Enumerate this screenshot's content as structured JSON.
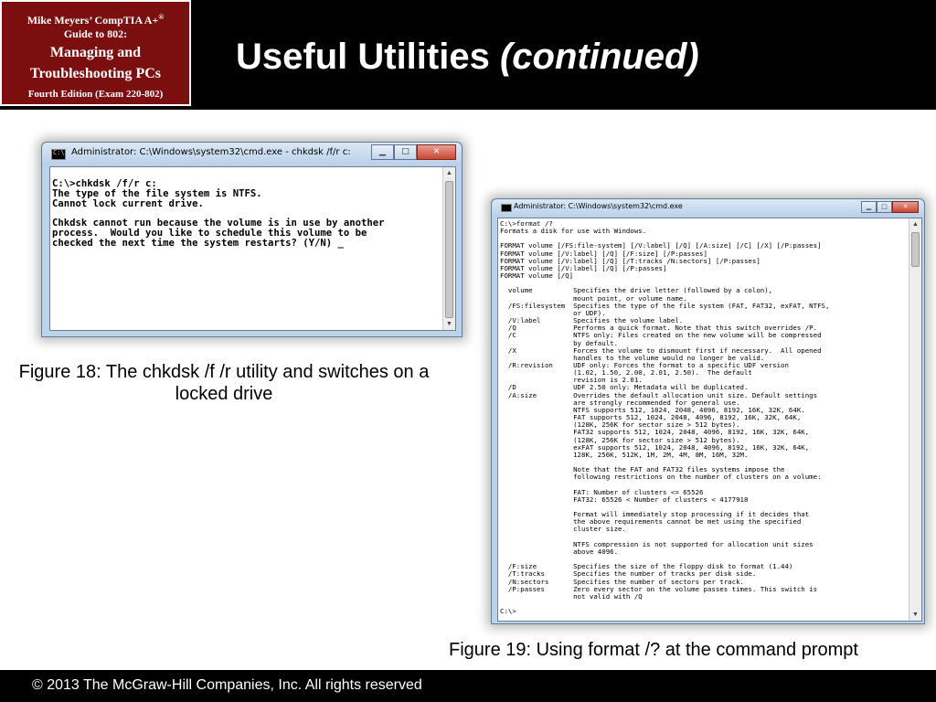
{
  "header": {
    "badge": {
      "line1": "Mike Meyers’ CompTIA A+",
      "registered": "®",
      "line2": "Guide to 802:",
      "line3": "Managing and",
      "line4": "Troubleshooting PCs",
      "line5": "Fourth Edition (Exam 220-802)"
    },
    "title": "Useful Utilities",
    "title_italic": "(continued)"
  },
  "window1": {
    "title": "Administrator: C:\\Windows\\system32\\cmd.exe - chkdsk  /f/r c:",
    "minimize": "▁",
    "maximize": "□",
    "close": "✕",
    "scroll_up": "▲",
    "scroll_down": "▼",
    "console_text": "C:\\>chkdsk /f/r c:\nThe type of the file system is NTFS.\nCannot lock current drive.\n\nChkdsk cannot run because the volume is in use by another\nprocess.  Would you like to schedule this volume to be\nchecked the next time the system restarts? (Y/N) _"
  },
  "window2": {
    "title": "Administrator: C:\\Windows\\system32\\cmd.exe",
    "minimize": "▁",
    "maximize": "□",
    "close": "✕",
    "scroll_up": "▲",
    "scroll_down": "▼",
    "console_text": "C:\\>format /?\nFormats a disk for use with Windows.\n\nFORMAT volume [/FS:file-system] [/V:label] [/Q] [/A:size] [/C] [/X] [/P:passes]\nFORMAT volume [/V:label] [/Q] [/F:size] [/P:passes]\nFORMAT volume [/V:label] [/Q] [/T:tracks /N:sectors] [/P:passes]\nFORMAT volume [/V:label] [/Q] [/P:passes]\nFORMAT volume [/Q]\n\n  volume          Specifies the drive letter (followed by a colon),\n                  mount point, or volume name.\n  /FS:filesystem  Specifies the type of the file system (FAT, FAT32, exFAT, NTFS,\n                  or UDF).\n  /V:label        Specifies the volume label.\n  /Q              Performs a quick format. Note that this switch overrides /P.\n  /C              NTFS only: Files created on the new volume will be compressed\n                  by default.\n  /X              Forces the volume to dismount first if necessary.  All opened\n                  handles to the volume would no longer be valid.\n  /R:revision     UDF only: Forces the format to a specific UDF version\n                  (1.02, 1.50, 2.00, 2.01, 2.50).  The default\n                  revision is 2.01.\n  /D              UDF 2.50 only: Metadata will be duplicated.\n  /A:size         Overrides the default allocation unit size. Default settings\n                  are strongly recommended for general use.\n                  NTFS supports 512, 1024, 2048, 4096, 8192, 16K, 32K, 64K.\n                  FAT supports 512, 1024, 2048, 4096, 8192, 16K, 32K, 64K,\n                  (128K, 256K for sector size > 512 bytes).\n                  FAT32 supports 512, 1024, 2048, 4096, 8192, 16K, 32K, 64K,\n                  (128K, 256K for sector size > 512 bytes).\n                  exFAT supports 512, 1024, 2048, 4096, 8192, 16K, 32K, 64K,\n                  128K, 256K, 512K, 1M, 2M, 4M, 8M, 16M, 32M.\n\n                  Note that the FAT and FAT32 files systems impose the\n                  following restrictions on the number of clusters on a volume:\n\n                  FAT: Number of clusters <= 65526\n                  FAT32: 65526 < Number of clusters < 4177918\n\n                  Format will immediately stop processing if it decides that\n                  the above requirements cannot be met using the specified\n                  cluster size.\n\n                  NTFS compression is not supported for allocation unit sizes\n                  above 4096.\n\n  /F:size         Specifies the size of the floppy disk to format (1.44)\n  /T:tracks       Specifies the number of tracks per disk side.\n  /N:sectors      Specifies the number of sectors per track.\n  /P:passes       Zero every sector on the volume passes times. This switch is\n                  not valid with /Q\n\nC:\\>"
  },
  "captions": {
    "figure18": "Figure 18: The chkdsk /f /r utility and switches on a locked drive",
    "figure19": "Figure 19: Using format /? at the command prompt"
  },
  "footer": {
    "copyright": "© 2013 The McGraw-Hill Companies, Inc. All rights reserved"
  },
  "colors": {
    "header_bg": "#000000",
    "badge_bg": "#7b0e0e",
    "console_bg": "#ffffff",
    "window_frame": "#bcd3ea"
  }
}
